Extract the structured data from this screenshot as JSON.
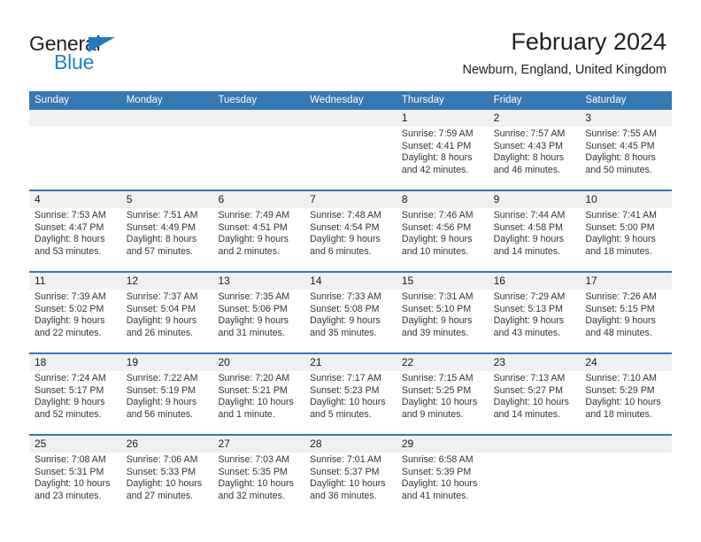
{
  "brand": {
    "name_line1": "General",
    "name_line2": "Blue",
    "accent_color": "#2283c8"
  },
  "header": {
    "title": "February 2024",
    "location": "Newburn, England, United Kingdom"
  },
  "theme": {
    "header_blue": "#3478b4",
    "daynum_band": "#f0f0f0",
    "text": "#333333"
  },
  "calendar": {
    "weekday_headers": [
      "Sunday",
      "Monday",
      "Tuesday",
      "Wednesday",
      "Thursday",
      "Friday",
      "Saturday"
    ],
    "weeks": [
      [
        {
          "day": "",
          "lines": []
        },
        {
          "day": "",
          "lines": []
        },
        {
          "day": "",
          "lines": []
        },
        {
          "day": "",
          "lines": []
        },
        {
          "day": "1",
          "lines": [
            "Sunrise: 7:59 AM",
            "Sunset: 4:41 PM",
            "Daylight: 8 hours",
            "and 42 minutes."
          ]
        },
        {
          "day": "2",
          "lines": [
            "Sunrise: 7:57 AM",
            "Sunset: 4:43 PM",
            "Daylight: 8 hours",
            "and 46 minutes."
          ]
        },
        {
          "day": "3",
          "lines": [
            "Sunrise: 7:55 AM",
            "Sunset: 4:45 PM",
            "Daylight: 8 hours",
            "and 50 minutes."
          ]
        }
      ],
      [
        {
          "day": "4",
          "lines": [
            "Sunrise: 7:53 AM",
            "Sunset: 4:47 PM",
            "Daylight: 8 hours",
            "and 53 minutes."
          ]
        },
        {
          "day": "5",
          "lines": [
            "Sunrise: 7:51 AM",
            "Sunset: 4:49 PM",
            "Daylight: 8 hours",
            "and 57 minutes."
          ]
        },
        {
          "day": "6",
          "lines": [
            "Sunrise: 7:49 AM",
            "Sunset: 4:51 PM",
            "Daylight: 9 hours",
            "and 2 minutes."
          ]
        },
        {
          "day": "7",
          "lines": [
            "Sunrise: 7:48 AM",
            "Sunset: 4:54 PM",
            "Daylight: 9 hours",
            "and 6 minutes."
          ]
        },
        {
          "day": "8",
          "lines": [
            "Sunrise: 7:46 AM",
            "Sunset: 4:56 PM",
            "Daylight: 9 hours",
            "and 10 minutes."
          ]
        },
        {
          "day": "9",
          "lines": [
            "Sunrise: 7:44 AM",
            "Sunset: 4:58 PM",
            "Daylight: 9 hours",
            "and 14 minutes."
          ]
        },
        {
          "day": "10",
          "lines": [
            "Sunrise: 7:41 AM",
            "Sunset: 5:00 PM",
            "Daylight: 9 hours",
            "and 18 minutes."
          ]
        }
      ],
      [
        {
          "day": "11",
          "lines": [
            "Sunrise: 7:39 AM",
            "Sunset: 5:02 PM",
            "Daylight: 9 hours",
            "and 22 minutes."
          ]
        },
        {
          "day": "12",
          "lines": [
            "Sunrise: 7:37 AM",
            "Sunset: 5:04 PM",
            "Daylight: 9 hours",
            "and 26 minutes."
          ]
        },
        {
          "day": "13",
          "lines": [
            "Sunrise: 7:35 AM",
            "Sunset: 5:06 PM",
            "Daylight: 9 hours",
            "and 31 minutes."
          ]
        },
        {
          "day": "14",
          "lines": [
            "Sunrise: 7:33 AM",
            "Sunset: 5:08 PM",
            "Daylight: 9 hours",
            "and 35 minutes."
          ]
        },
        {
          "day": "15",
          "lines": [
            "Sunrise: 7:31 AM",
            "Sunset: 5:10 PM",
            "Daylight: 9 hours",
            "and 39 minutes."
          ]
        },
        {
          "day": "16",
          "lines": [
            "Sunrise: 7:29 AM",
            "Sunset: 5:13 PM",
            "Daylight: 9 hours",
            "and 43 minutes."
          ]
        },
        {
          "day": "17",
          "lines": [
            "Sunrise: 7:26 AM",
            "Sunset: 5:15 PM",
            "Daylight: 9 hours",
            "and 48 minutes."
          ]
        }
      ],
      [
        {
          "day": "18",
          "lines": [
            "Sunrise: 7:24 AM",
            "Sunset: 5:17 PM",
            "Daylight: 9 hours",
            "and 52 minutes."
          ]
        },
        {
          "day": "19",
          "lines": [
            "Sunrise: 7:22 AM",
            "Sunset: 5:19 PM",
            "Daylight: 9 hours",
            "and 56 minutes."
          ]
        },
        {
          "day": "20",
          "lines": [
            "Sunrise: 7:20 AM",
            "Sunset: 5:21 PM",
            "Daylight: 10 hours",
            "and 1 minute."
          ]
        },
        {
          "day": "21",
          "lines": [
            "Sunrise: 7:17 AM",
            "Sunset: 5:23 PM",
            "Daylight: 10 hours",
            "and 5 minutes."
          ]
        },
        {
          "day": "22",
          "lines": [
            "Sunrise: 7:15 AM",
            "Sunset: 5:25 PM",
            "Daylight: 10 hours",
            "and 9 minutes."
          ]
        },
        {
          "day": "23",
          "lines": [
            "Sunrise: 7:13 AM",
            "Sunset: 5:27 PM",
            "Daylight: 10 hours",
            "and 14 minutes."
          ]
        },
        {
          "day": "24",
          "lines": [
            "Sunrise: 7:10 AM",
            "Sunset: 5:29 PM",
            "Daylight: 10 hours",
            "and 18 minutes."
          ]
        }
      ],
      [
        {
          "day": "25",
          "lines": [
            "Sunrise: 7:08 AM",
            "Sunset: 5:31 PM",
            "Daylight: 10 hours",
            "and 23 minutes."
          ]
        },
        {
          "day": "26",
          "lines": [
            "Sunrise: 7:06 AM",
            "Sunset: 5:33 PM",
            "Daylight: 10 hours",
            "and 27 minutes."
          ]
        },
        {
          "day": "27",
          "lines": [
            "Sunrise: 7:03 AM",
            "Sunset: 5:35 PM",
            "Daylight: 10 hours",
            "and 32 minutes."
          ]
        },
        {
          "day": "28",
          "lines": [
            "Sunrise: 7:01 AM",
            "Sunset: 5:37 PM",
            "Daylight: 10 hours",
            "and 36 minutes."
          ]
        },
        {
          "day": "29",
          "lines": [
            "Sunrise: 6:58 AM",
            "Sunset: 5:39 PM",
            "Daylight: 10 hours",
            "and 41 minutes."
          ]
        },
        {
          "day": "",
          "lines": []
        },
        {
          "day": "",
          "lines": []
        }
      ]
    ]
  }
}
